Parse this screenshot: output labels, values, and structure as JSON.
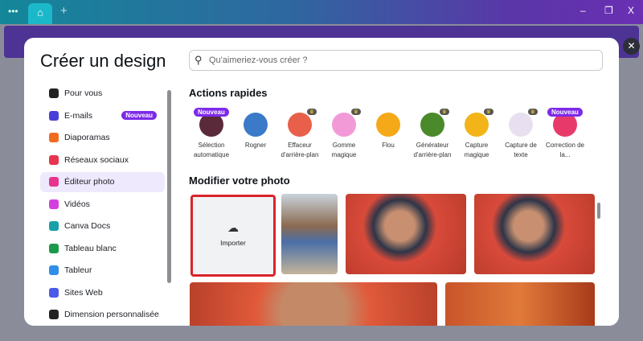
{
  "window": {
    "tab_icon": "home-icon",
    "menu_icon": "dots-icon",
    "new_tab_icon": "plus-icon",
    "minimize": "–",
    "restore": "❐",
    "close": "X"
  },
  "modal": {
    "title": "Créer un design",
    "close": "✕",
    "search": {
      "placeholder": "Qu'aimeriez-vous créer ?",
      "icon": "search-icon"
    },
    "sidebar": {
      "items": [
        {
          "label": "Pour vous",
          "icon": "sparkle-icon",
          "color": "#222222"
        },
        {
          "label": "E-mails",
          "icon": "mail-icon",
          "color": "#4a3fd8",
          "badge": "Nouveau"
        },
        {
          "label": "Diaporamas",
          "icon": "presentation-icon",
          "color": "#f26b1d"
        },
        {
          "label": "Réseaux sociaux",
          "icon": "heart-icon",
          "color": "#e8344e"
        },
        {
          "label": "Éditeur photo",
          "icon": "camera-icon",
          "color": "#e8348e",
          "selected": true
        },
        {
          "label": "Vidéos",
          "icon": "video-icon",
          "color": "#d43ee0"
        },
        {
          "label": "Canva Docs",
          "icon": "doc-icon",
          "color": "#16a0a8"
        },
        {
          "label": "Tableau blanc",
          "icon": "whiteboard-icon",
          "color": "#1a9a4a"
        },
        {
          "label": "Tableur",
          "icon": "sheet-icon",
          "color": "#2f8ee8"
        },
        {
          "label": "Sites Web",
          "icon": "website-icon",
          "color": "#4a5be8"
        },
        {
          "label": "Dimension personnalisée",
          "icon": "custom-size-icon",
          "color": "#222222"
        }
      ]
    },
    "quick_actions": {
      "heading": "Actions rapides",
      "items": [
        {
          "label": "Sélection automatique",
          "badge": "Nouveau",
          "color": "#5a2a3a"
        },
        {
          "label": "Rogner",
          "color": "#3a7ac8"
        },
        {
          "label": "Effaceur d'arrière-plan",
          "premium": true,
          "color": "#e8604a"
        },
        {
          "label": "Gomme magique",
          "premium": true,
          "color": "#f29ad8"
        },
        {
          "label": "Flou",
          "color": "#f5a818"
        },
        {
          "label": "Générateur d'arrière-plan",
          "premium": true,
          "color": "#4a8a2a"
        },
        {
          "label": "Capture magique",
          "premium": true,
          "color": "#f2b418"
        },
        {
          "label": "Capture de texte",
          "premium": true,
          "color": "#e8e0f0"
        },
        {
          "label": "Correction de la...",
          "badge": "Nouveau",
          "color": "#e83a6a"
        }
      ]
    },
    "photos": {
      "heading": "Modifier votre photo",
      "import_label": "Importer",
      "import_icon": "cloud-upload-icon"
    }
  },
  "colors": {
    "accent": "#7d2ae8",
    "import_border": "#d9242b"
  }
}
